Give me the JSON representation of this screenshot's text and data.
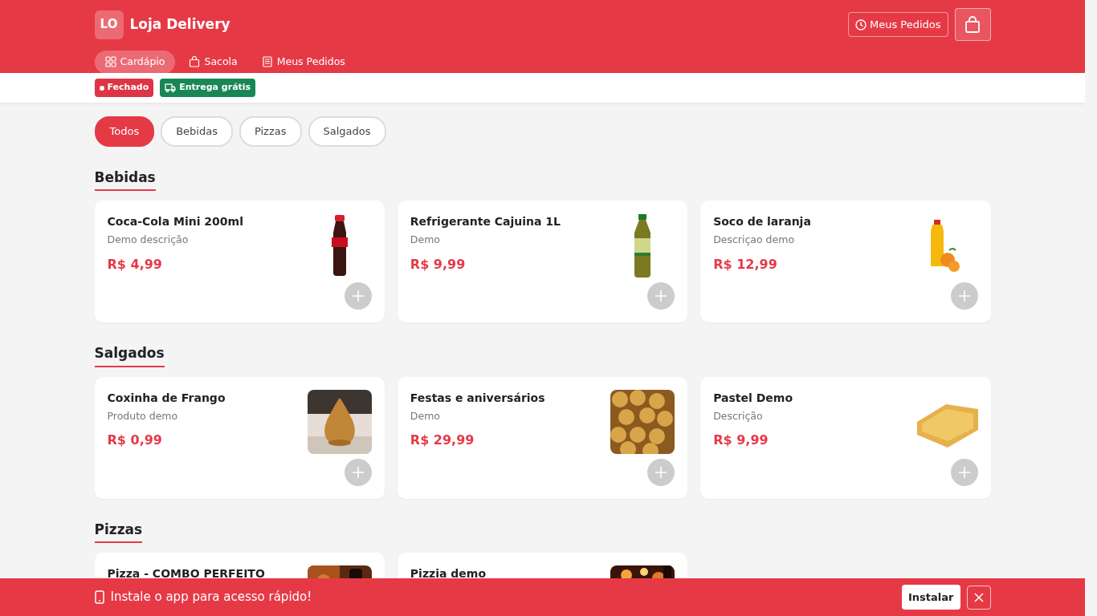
{
  "store": {
    "logo": "LO",
    "name": "Loja Delivery"
  },
  "header_button": "Meus Pedidos",
  "nav": [
    {
      "label": "Cardápio",
      "selected": true
    },
    {
      "label": "Sacola",
      "selected": false
    },
    {
      "label": "Meus Pedidos",
      "selected": false
    }
  ],
  "status_badges": [
    {
      "label": "Fechado",
      "kind": "status"
    },
    {
      "label": "Entrega grátis",
      "kind": "delivery"
    }
  ],
  "filters": [
    {
      "label": "Todos",
      "selected": true
    },
    {
      "label": "Bebidas",
      "selected": false
    },
    {
      "label": "Pizzas",
      "selected": false
    },
    {
      "label": "Salgados",
      "selected": false
    }
  ],
  "sections": [
    {
      "title": "Bebidas",
      "products": [
        {
          "name": "Coca-Cola Mini 200ml",
          "description": "Demo descrição",
          "price": "R$ 4,99"
        },
        {
          "name": "Refrigerante Cajuina 1L",
          "description": "Demo",
          "price": "R$ 9,99"
        },
        {
          "name": "Soco de laranja",
          "description": "Descriçao demo",
          "price": "R$ 12,99"
        }
      ]
    },
    {
      "title": "Salgados",
      "products": [
        {
          "name": "Coxinha de Frango",
          "description": "Produto demo",
          "price": "R$ 0,99"
        },
        {
          "name": "Festas e aniversários",
          "description": "Demo",
          "price": "R$ 29,99"
        },
        {
          "name": "Pastel Demo",
          "description": "Descrição",
          "price": "R$ 9,99"
        }
      ]
    },
    {
      "title": "Pizzas",
      "products": [
        {
          "name": "Pizza - COMBO PERFEITO"
        },
        {
          "name": "Pizzia demo"
        }
      ]
    }
  ],
  "install_banner": {
    "message": "Instale o app para acesso rápido!",
    "button": "Instalar"
  }
}
